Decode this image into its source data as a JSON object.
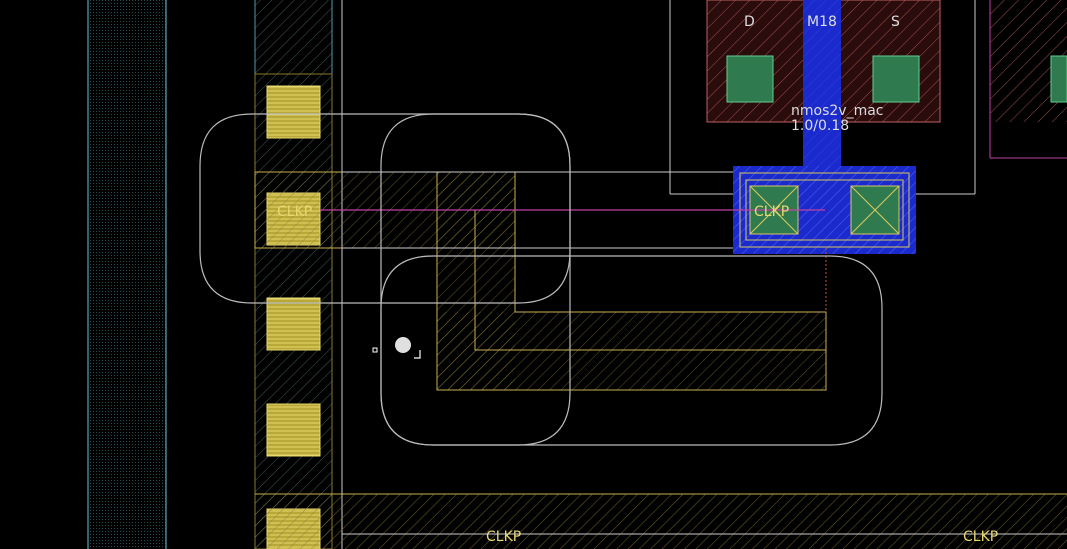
{
  "layout_view": {
    "net_labels": [
      "CLKP",
      "CLKP",
      "CLKP",
      "CLKP"
    ],
    "device": {
      "name": "M18",
      "model": "nmos2v_mac",
      "size": "1.0/0.18",
      "pin_left": "D",
      "pin_right": "S"
    },
    "colors": {
      "background": "#000000",
      "metal1": "#d8c860",
      "poly": "#1a2acc",
      "diffusion": "#6b1e1e",
      "contact": "#2f7a4f",
      "route_outline": "#bbbbbb",
      "nwell_line": "#4fa6b8",
      "probe_line": "#c040a0"
    }
  }
}
